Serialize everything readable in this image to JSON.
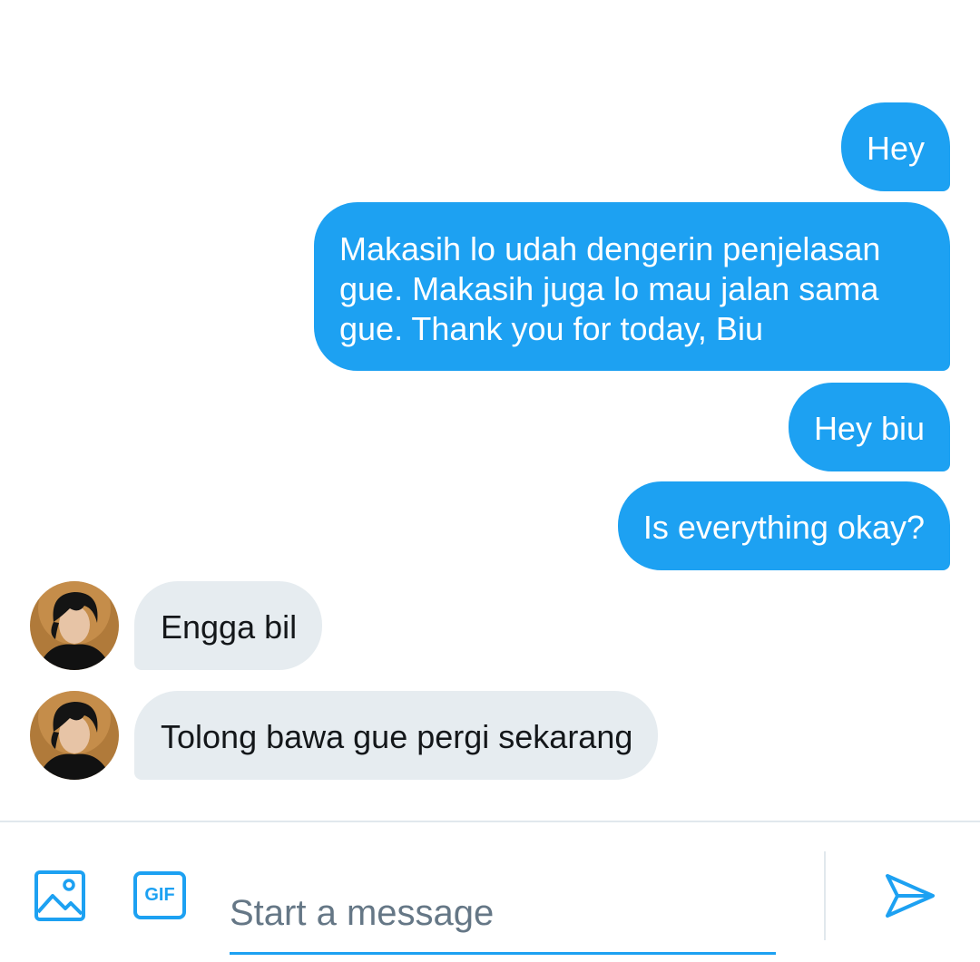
{
  "messages": [
    {
      "direction": "outgoing",
      "text": "Hey"
    },
    {
      "direction": "outgoing",
      "text_lines": [
        "Makasih lo udah dengerin penjelasan",
        "gue. Makasih juga lo mau jalan sama",
        "gue. Thank you for today, Biu"
      ]
    },
    {
      "direction": "outgoing",
      "text": "Hey biu"
    },
    {
      "direction": "outgoing",
      "text": "Is everything okay?"
    },
    {
      "direction": "incoming",
      "text": "Engga bil",
      "avatar": "contact-avatar"
    },
    {
      "direction": "incoming",
      "text": "Tolong bawa gue pergi sekarang",
      "avatar": "contact-avatar"
    }
  ],
  "composer": {
    "placeholder": "Start a message",
    "media_icon": "image-icon",
    "gif_label": "GIF",
    "send_icon": "send-icon"
  },
  "colors": {
    "outgoing_bubble": "#1da1f2",
    "incoming_bubble": "#e6ecf0",
    "accent": "#1da1f2",
    "placeholder": "#657786"
  }
}
